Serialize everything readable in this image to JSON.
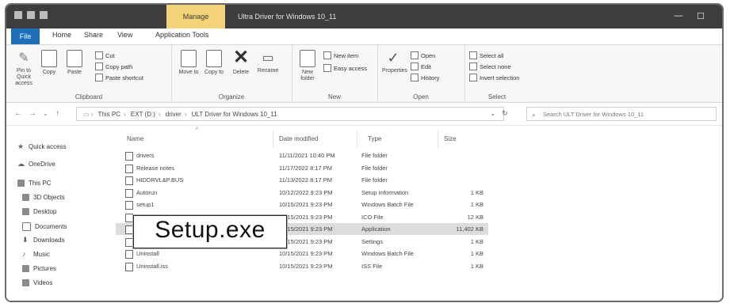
{
  "titlebar": {
    "context_tab": "Manage",
    "title": "Ultra Driver for Windows 10_11",
    "controls": {
      "minimize": "—",
      "maximize": "☐",
      "close": "✕"
    }
  },
  "ribbon_tabs": {
    "file": "File",
    "home": "Home",
    "share": "Share",
    "view": "View",
    "application_tools": "Application Tools"
  },
  "ribbon": {
    "clipboard": {
      "label": "Clipboard",
      "pin": "Pin to Quick access",
      "copy": "Copy",
      "paste": "Paste",
      "cut": "Cut",
      "copy_path": "Copy path",
      "paste_shortcut": "Paste shortcut"
    },
    "organize": {
      "label": "Organize",
      "move_to": "Move to",
      "copy_to": "Copy to",
      "delete": "Delete",
      "rename": "Rename"
    },
    "new": {
      "label": "New",
      "new_folder": "New folder",
      "new_item": "New item",
      "easy_access": "Easy access"
    },
    "open": {
      "label": "Open",
      "properties": "Properties",
      "open": "Open",
      "edit": "Edit",
      "history": "History"
    },
    "select": {
      "label": "Select",
      "select_all": "Select all",
      "select_none": "Select none",
      "invert": "Invert selection"
    }
  },
  "address": {
    "back": "←",
    "forward": "→",
    "up": "↑",
    "crumbs": [
      "This PC",
      "EXT (D:)",
      "driver",
      "ULT Driver for Windows 10_11"
    ],
    "search_placeholder": "Search ULT Driver for Windows 10_11"
  },
  "nav": {
    "quick_access": "Quick access",
    "onedrive": "OneDrive",
    "this_pc": "This PC",
    "items": [
      "3D Objects",
      "Desktop",
      "Documents",
      "Downloads",
      "Music",
      "Pictures",
      "Videos"
    ]
  },
  "columns": {
    "name": "Name",
    "date": "Date modified",
    "type": "Type",
    "size": "Size"
  },
  "files": [
    {
      "name": "drivers",
      "date": "11/11/2021 10:40 PM",
      "type": "File folder",
      "size": ""
    },
    {
      "name": "Release notes",
      "date": "11/17/2022 8:17 PM",
      "type": "File folder",
      "size": ""
    },
    {
      "name": "HIDDRVL&P.BUS",
      "date": "11/13/2022 8:17 PM",
      "type": "File folder",
      "size": ""
    },
    {
      "name": "Autorun",
      "date": "10/12/2022 9:23 PM",
      "type": "Setup Information",
      "size": "1 KB"
    },
    {
      "name": "setup1",
      "date": "10/15/2021 9:23 PM",
      "type": "Windows Batch File",
      "size": "1 KB"
    },
    {
      "name": "icon",
      "date": "10/15/2021 9:23 PM",
      "type": "ICO File",
      "size": "12 KB"
    },
    {
      "name": "Setup",
      "date": "10/15/2021 9:23 PM",
      "type": "Application",
      "size": "11,402 KB"
    },
    {
      "name": "Setup.ini",
      "date": "10/15/2021 9:23 PM",
      "type": "Settings",
      "size": "1 KB"
    },
    {
      "name": "Uninstall",
      "date": "10/15/2021 9:23 PM",
      "type": "Windows Batch File",
      "size": "1 KB"
    },
    {
      "name": "Uninstall.iss",
      "date": "10/15/2021 9:23 PM",
      "type": "ISS File",
      "size": "1 KB"
    }
  ],
  "callout": "Setup.exe"
}
